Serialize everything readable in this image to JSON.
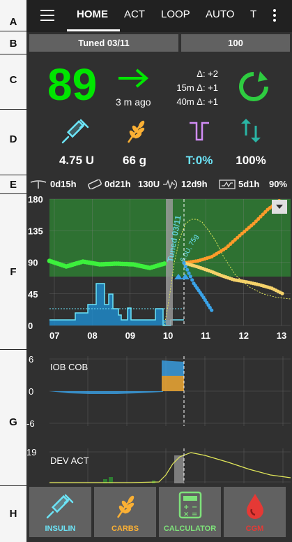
{
  "sections": [
    "A",
    "B",
    "C",
    "D",
    "E",
    "F",
    "G",
    "H"
  ],
  "toolbar": {
    "tabs": [
      {
        "label": "HOME",
        "active": true
      },
      {
        "label": "ACT"
      },
      {
        "label": "LOOP"
      },
      {
        "label": "AUTO"
      },
      {
        "label": "T"
      }
    ]
  },
  "profile_button": "Tuned 03/11",
  "target_button": "100",
  "overview": {
    "bg": "89",
    "ago": "3 m ago",
    "deltas": [
      "Δ: +2",
      "15m Δ: +1",
      "40m Δ: +1"
    ],
    "bg_color": "#00e600"
  },
  "status_row": {
    "iob": "4.75 U",
    "cob": "66 g",
    "temp_basal": "T:0%",
    "profile_pct": "100%"
  },
  "status_lights": {
    "cannula_age": "0d15h",
    "insulin_age": "0d21h",
    "reservoir": "130U",
    "sensor_age": "12d9h",
    "battery_age": "5d1h",
    "battery_level": "90%"
  },
  "main_graph": {
    "y_ticks": [
      "180",
      "135",
      "90",
      "45",
      "0"
    ],
    "x_ticks": [
      "07",
      "08",
      "09",
      "10",
      "11",
      "12",
      "13"
    ],
    "profile_annotation": "Tuned 03/11",
    "carb_annotation": "6.0U, 75g"
  },
  "iob_cob_graph": {
    "label": "IOB COB",
    "y_ticks": [
      "6",
      "0",
      "-6"
    ]
  },
  "dev_act_graph": {
    "label": "DEV ACT",
    "y_ticks": [
      "19"
    ]
  },
  "actions": [
    {
      "label": "INSULIN",
      "color": "#6ce4f7"
    },
    {
      "label": "CARBS",
      "color": "#fbb034"
    },
    {
      "label": "CALCULATOR",
      "color": "#7ee27a"
    },
    {
      "label": "CGM",
      "color": "#e53935"
    }
  ],
  "chart_data": {
    "type": "line",
    "x": [
      "07",
      "08",
      "09",
      "10",
      "11",
      "12",
      "13"
    ],
    "series": [
      {
        "values": [
          92,
          84,
          91,
          87,
          88,
          87,
          82,
          89
        ]
      },
      {
        "values": [
          89,
          92,
          98,
          110,
          128,
          145,
          165,
          180
        ]
      },
      {
        "values": [
          89,
          84,
          78,
          71,
          65,
          62,
          58,
          53,
          44
        ]
      },
      {
        "values": [
          89,
          60,
          40,
          18
        ]
      }
    ],
    "ylim": [
      0,
      180
    ],
    "grid": true
  }
}
